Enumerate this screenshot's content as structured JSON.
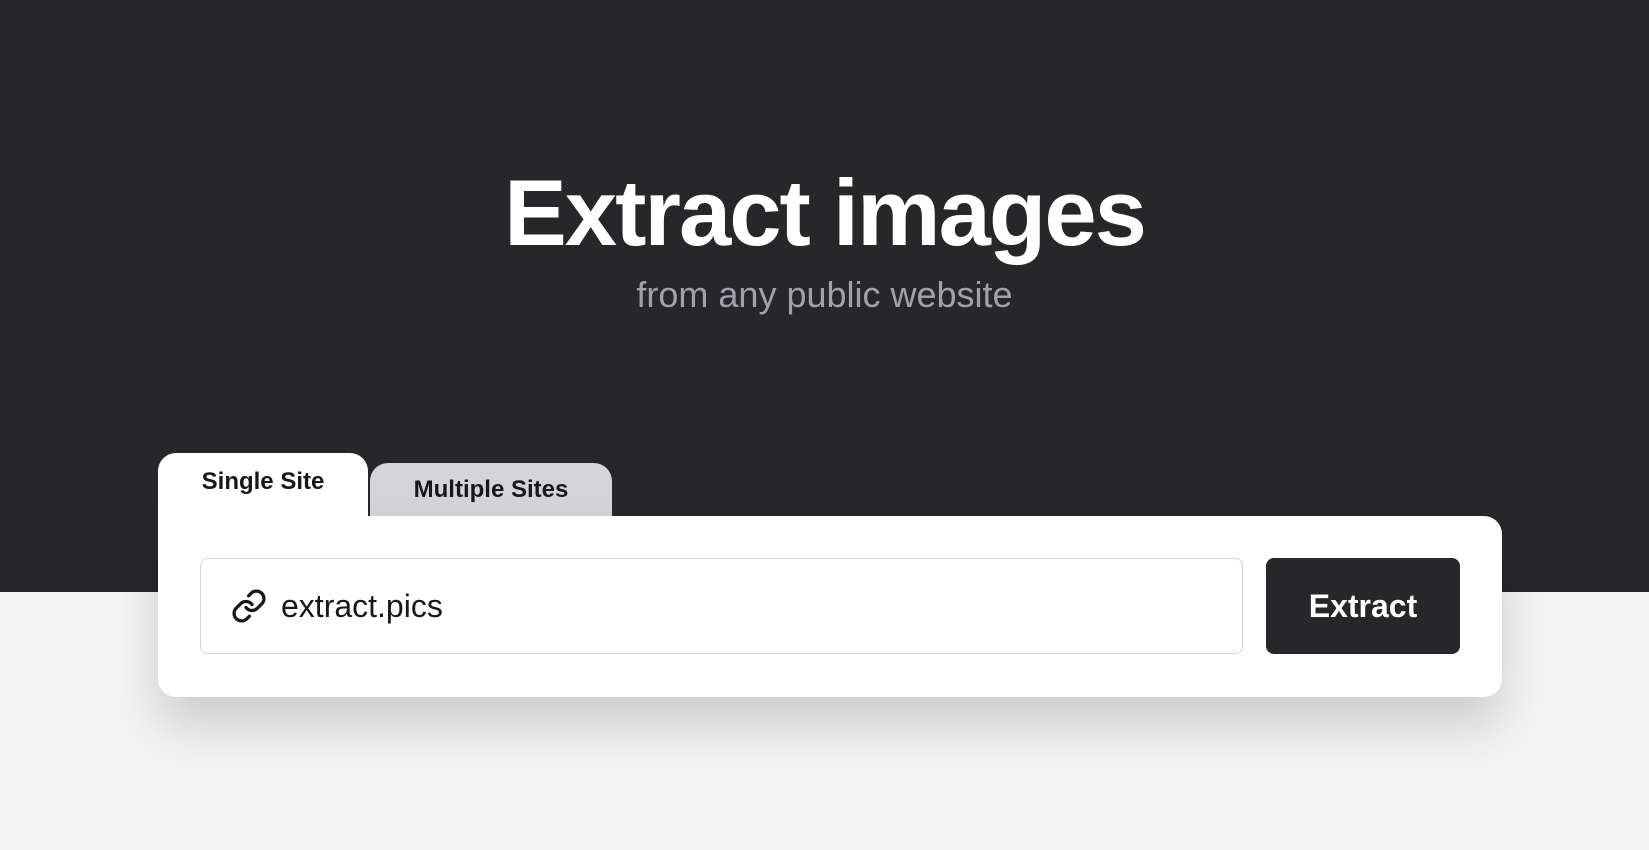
{
  "hero": {
    "title": "Extract images",
    "subtitle": "from any public website"
  },
  "tabs": [
    {
      "label": "Single Site",
      "active": true
    },
    {
      "label": "Multiple Sites",
      "active": false
    }
  ],
  "url_input": {
    "value": "extract.pics",
    "icon": "link-icon"
  },
  "extract_button": {
    "label": "Extract"
  },
  "colors": {
    "hero_background": "#27272a",
    "page_background": "#f4f4f4",
    "title_text": "#ffffff",
    "subtitle_text": "#a1a1aa",
    "active_tab": "#ffffff",
    "inactive_tab": "#d4d4d8",
    "button_background": "#27272a"
  }
}
